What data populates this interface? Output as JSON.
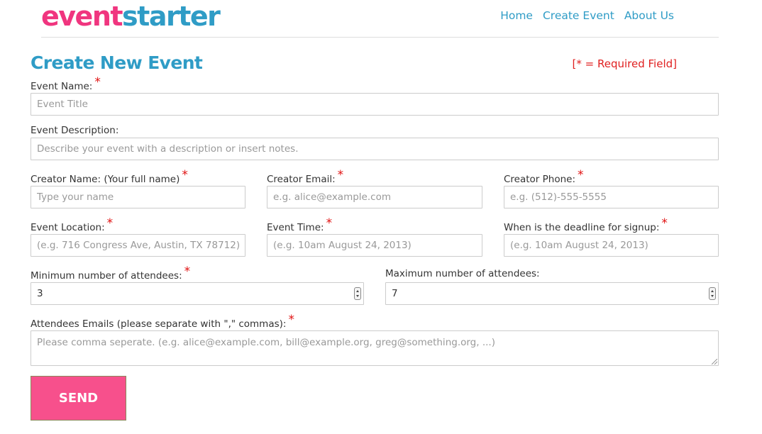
{
  "header": {
    "logo_part1": "event",
    "logo_part2": "starter",
    "nav": [
      "Home",
      "Create Event",
      "About Us"
    ]
  },
  "form": {
    "title": "Create New Event",
    "required_note": "[* = Required Field]",
    "required_marker": "*",
    "event_name": {
      "label": "Event Name:",
      "placeholder": "Event Title"
    },
    "event_description": {
      "label": "Event Description:",
      "placeholder": "Describe your event with a description or insert notes."
    },
    "creator_name": {
      "label": "Creator Name: (Your full name)",
      "placeholder": "Type your name"
    },
    "creator_email": {
      "label": "Creator Email:",
      "placeholder": "e.g. alice@example.com"
    },
    "creator_phone": {
      "label": "Creator Phone:",
      "placeholder": "e.g. (512)-555-5555"
    },
    "event_location": {
      "label": "Event Location:",
      "placeholder": "(e.g. 716 Congress Ave, Austin, TX 78712)"
    },
    "event_time": {
      "label": "Event Time:",
      "placeholder": "(e.g. 10am August 24, 2013)"
    },
    "signup_deadline": {
      "label": "When is the deadline for signup:",
      "placeholder": "(e.g. 10am August 24, 2013)"
    },
    "min_attendees": {
      "label": "Minimum number of attendees:",
      "value": "3"
    },
    "max_attendees": {
      "label": "Maximum number of attendees:",
      "value": "7"
    },
    "attendee_emails": {
      "label": "Attendees Emails (please separate with \",\" commas):",
      "placeholder": "Please comma seperate. (e.g. alice@example.com, bill@example.org, greg@something.org, ...)"
    },
    "send_label": "SEND"
  },
  "colors": {
    "brand_pink": "#f0357f",
    "brand_blue": "#2f9cc6",
    "required_red": "#e01010",
    "button_pink": "#f7508c"
  }
}
